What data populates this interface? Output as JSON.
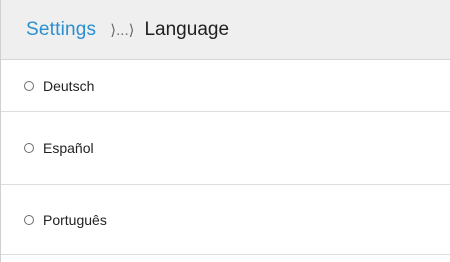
{
  "header": {
    "root_label": "Settings",
    "separator": "⟩...⟩",
    "current_label": "Language"
  },
  "languages": [
    {
      "label": "Deutsch",
      "selected": false
    },
    {
      "label": "Español",
      "selected": false
    },
    {
      "label": "Português",
      "selected": false
    }
  ],
  "colors": {
    "accent": "#2a8fd0",
    "header_bg": "#efefef"
  }
}
